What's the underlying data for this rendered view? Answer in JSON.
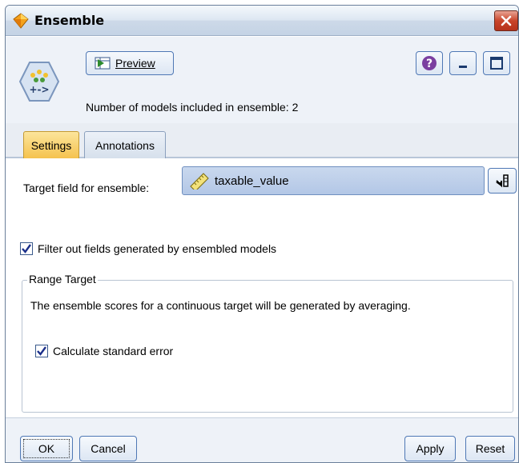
{
  "window": {
    "title": "Ensemble",
    "close_icon": "close-icon",
    "accent_color": "#c9442a"
  },
  "toolbar": {
    "preview_label": "Preview",
    "help_icon": "help-icon",
    "minimize_icon": "minimize-icon",
    "maximize_icon": "maximize-icon",
    "node_icon": "ensemble-node-icon"
  },
  "header": {
    "models_text": "Number of models included in ensemble: 2"
  },
  "tabs": [
    {
      "label": "Settings",
      "active": true
    },
    {
      "label": "Annotations",
      "active": false
    }
  ],
  "settings": {
    "target_label": "Target field for ensemble:",
    "target_value": "taxable_value",
    "target_icon": "ruler-icon",
    "filter_label": "Filter out fields generated by ensembled models",
    "filter_checked": true,
    "range_group": {
      "legend": "Range Target",
      "description": "The ensemble scores for a continuous target will be generated by averaging.",
      "stderr_label": "Calculate standard error",
      "stderr_checked": true
    }
  },
  "footer": {
    "ok_label": "OK",
    "cancel_label": "Cancel",
    "apply_label": "Apply",
    "reset_label": "Reset"
  }
}
